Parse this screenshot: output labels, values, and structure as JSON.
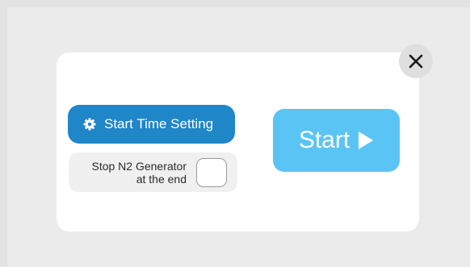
{
  "colors": {
    "page_background": "#e4e3e4",
    "dialog_background": "#ffffff",
    "primary_button": "#1f86c7",
    "start_button": "#5ac4f4",
    "close_button": "#dfdfdf",
    "option_background": "#f0f0f0"
  },
  "dialog": {
    "close_icon": "close-icon",
    "start_time_button": {
      "icon": "gear-icon",
      "label": "Start Time Setting"
    },
    "stop_generator_option": {
      "label_line1": "Stop N2 Generator",
      "label_line2": "at the end",
      "checked": false
    },
    "start_button": {
      "label": "Start",
      "icon": "play-icon"
    }
  }
}
